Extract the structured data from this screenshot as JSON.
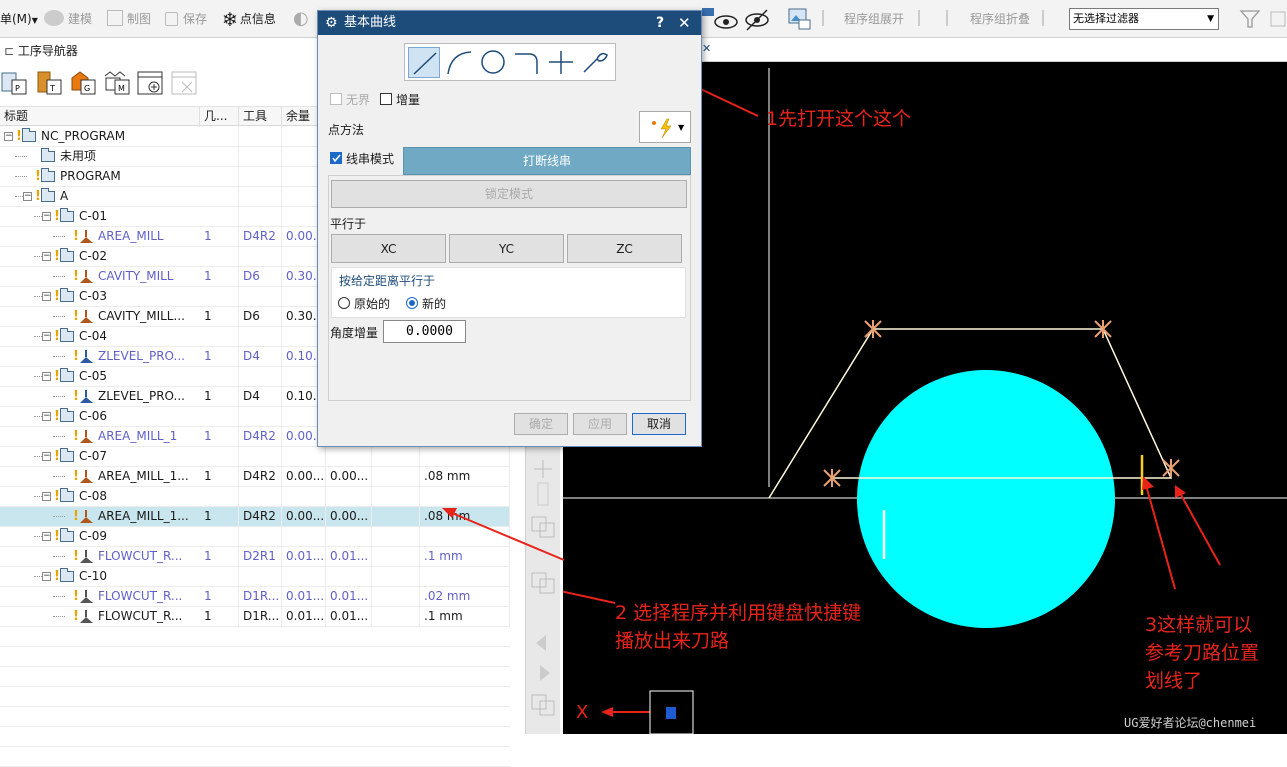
{
  "toolbar": {
    "menu_label": "单(M)",
    "menu_arrow": "▼",
    "build": "建模",
    "draft": "制图",
    "save": "保存",
    "info": "点信息",
    "expand_groups": "程序组展开",
    "collapse_groups": "程序组折叠",
    "filter_value": "无选择过滤器"
  },
  "navigator": {
    "title": "工序导航器",
    "columns": [
      "标题",
      "几...",
      "工具",
      "余量",
      "",
      "",
      ""
    ],
    "rows": [
      {
        "name": "NC_PROGRAM",
        "level": 0,
        "type": "program",
        "col2": "",
        "col3": "",
        "col4": "",
        "col5": "",
        "col7": ""
      },
      {
        "name": "未用项",
        "level": 1,
        "type": "folder",
        "col2": "",
        "col3": "",
        "col4": "",
        "col5": "",
        "col7": ""
      },
      {
        "name": "PROGRAM",
        "level": 1,
        "type": "program",
        "col2": "",
        "col3": "",
        "col4": "",
        "col5": "",
        "col7": ""
      },
      {
        "name": "A",
        "level": 1,
        "type": "program",
        "col2": "",
        "col3": "",
        "col4": "",
        "col5": "",
        "col7": ""
      },
      {
        "name": "C-01",
        "level": 2,
        "type": "program",
        "col2": "",
        "col3": "",
        "col4": "",
        "col5": "",
        "col7": ""
      },
      {
        "name": "AREA_MILL",
        "level": 3,
        "type": "op-area",
        "blue": true,
        "col2": "1",
        "col3": "D4R2",
        "col4": "0.00...",
        "col5": "",
        "col7": ""
      },
      {
        "name": "C-02",
        "level": 2,
        "type": "program",
        "col2": "",
        "col3": "",
        "col4": "",
        "col5": "",
        "col7": ""
      },
      {
        "name": "CAVITY_MILL",
        "level": 3,
        "type": "op-cavity",
        "blue": true,
        "col2": "1",
        "col3": "D6",
        "col4": "0.30...",
        "col5": "",
        "col7": ""
      },
      {
        "name": "C-03",
        "level": 2,
        "type": "program",
        "col2": "",
        "col3": "",
        "col4": "",
        "col5": "",
        "col7": ""
      },
      {
        "name": "CAVITY_MILL...",
        "level": 3,
        "type": "op-cavity",
        "blue": false,
        "col2": "1",
        "col3": "D6",
        "col4": "0.30...",
        "col5": "",
        "col7": ""
      },
      {
        "name": "C-04",
        "level": 2,
        "type": "program",
        "col2": "",
        "col3": "",
        "col4": "",
        "col5": "",
        "col7": ""
      },
      {
        "name": "ZLEVEL_PRO...",
        "level": 3,
        "type": "op-zlevel",
        "blue": true,
        "col2": "1",
        "col3": "D4",
        "col4": "0.10...",
        "col5": "",
        "col7": ""
      },
      {
        "name": "C-05",
        "level": 2,
        "type": "program",
        "col2": "",
        "col3": "",
        "col4": "",
        "col5": "",
        "col7": ""
      },
      {
        "name": "ZLEVEL_PRO...",
        "level": 3,
        "type": "op-zlevel",
        "blue": false,
        "col2": "1",
        "col3": "D4",
        "col4": "0.10...",
        "col5": "",
        "col7": ""
      },
      {
        "name": "C-06",
        "level": 2,
        "type": "program",
        "col2": "",
        "col3": "",
        "col4": "",
        "col5": "",
        "col7": ""
      },
      {
        "name": "AREA_MILL_1",
        "level": 3,
        "type": "op-area",
        "blue": true,
        "col2": "1",
        "col3": "D4R2",
        "col4": "0.00...",
        "col5": "",
        "col7": ""
      },
      {
        "name": "C-07",
        "level": 2,
        "type": "program",
        "col2": "",
        "col3": "",
        "col4": "",
        "col5": "",
        "col7": ""
      },
      {
        "name": "AREA_MILL_1...",
        "level": 3,
        "type": "op-area",
        "blue": false,
        "col2": "1",
        "col3": "D4R2",
        "col4": "0.00...",
        "col5": "0.00...",
        "col7": ".08 mm"
      },
      {
        "name": "C-08",
        "level": 2,
        "type": "program",
        "col2": "",
        "col3": "",
        "col4": "",
        "col5": "",
        "col7": ""
      },
      {
        "name": "AREA_MILL_1...",
        "level": 3,
        "type": "op-area",
        "blue": false,
        "selected": true,
        "col2": "1",
        "col3": "D4R2",
        "col4": "0.00...",
        "col5": "0.00...",
        "col7": ".08 mm"
      },
      {
        "name": "C-09",
        "level": 2,
        "type": "program",
        "col2": "",
        "col3": "",
        "col4": "",
        "col5": "",
        "col7": ""
      },
      {
        "name": "FLOWCUT_R...",
        "level": 3,
        "type": "op-flow",
        "blue": true,
        "col2": "1",
        "col3": "D2R1",
        "col4": "0.01...",
        "col5": "0.01...",
        "col7": ".1 mm"
      },
      {
        "name": "C-10",
        "level": 2,
        "type": "program",
        "col2": "",
        "col3": "",
        "col4": "",
        "col5": "",
        "col7": ""
      },
      {
        "name": "FLOWCUT_R...",
        "level": 3,
        "type": "op-flow",
        "blue": true,
        "col2": "1",
        "col3": "D1R...",
        "col4": "0.01...",
        "col5": "0.01...",
        "col7": ".02 mm"
      },
      {
        "name": "FLOWCUT_R...",
        "level": 3,
        "type": "op-flow",
        "blue": false,
        "col2": "1",
        "col3": "D1R...",
        "col4": "0.01...",
        "col5": "0.01...",
        "col7": ".1 mm"
      }
    ]
  },
  "dialog": {
    "title": "基本曲线",
    "help": "?",
    "close": "✕",
    "unbounded_label": "无界",
    "increment_label": "增量",
    "point_method_label": "点方法",
    "string_mode_label": "线串模式",
    "break_string_button": "打断线串",
    "lock_mode_button": "锁定模式",
    "parallel_to_label": "平行于",
    "xc": "XC",
    "yc": "YC",
    "zc": "ZC",
    "offset_parallel_label": "按给定距离平行于",
    "original_label": "原始的",
    "new_label": "新的",
    "angle_inc_label": "角度增量",
    "angle_inc_value": "0.0000",
    "ok": "确定",
    "apply": "应用",
    "cancel": "取消"
  },
  "annotations": {
    "a1": "1先打开这个这个",
    "a2_line1": "2 选择程序并利用键盘快捷键",
    "a2_line2": "播放出来刀路",
    "a3_line1": "3这样就可以",
    "a3_line2": "参考刀路位置",
    "a3_line3": "划线了",
    "x_label": "X"
  },
  "watermark": "UG爱好者论坛@chenmei",
  "colors": {
    "accent": "#1e4c7a",
    "highlight": "#c9e6ee",
    "annotation": "#e8241a",
    "circle": "#00ffff"
  }
}
